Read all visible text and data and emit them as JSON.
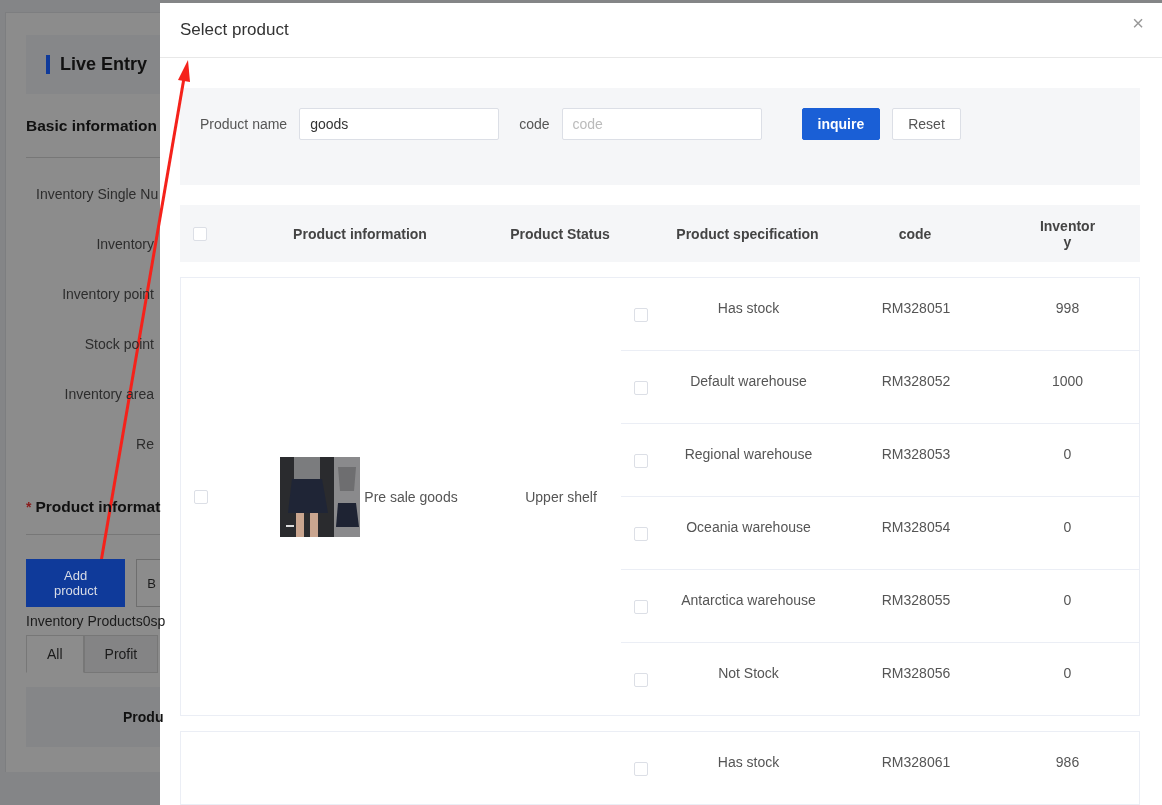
{
  "background_page": {
    "title": "Live Entry",
    "section_basic": "Basic information",
    "fields": [
      "Inventory Single Nu",
      "Inventory",
      "Inventory point",
      "Stock point",
      "Inventory area",
      "Re"
    ],
    "required_mark": "*",
    "section_product": "Product informat",
    "buttons": [
      "Add product",
      "B"
    ],
    "summary": "Inventory Products0sp",
    "tabs": [
      {
        "label": "All",
        "selected": true
      },
      {
        "label": "Profit",
        "selected": false
      }
    ],
    "table_header": "Produ"
  },
  "dialog": {
    "title": "Select product",
    "close": "×",
    "filters": [
      {
        "label": "Product name",
        "value": "goods"
      },
      {
        "label": "code",
        "placeholder": "code"
      }
    ],
    "buttons": [
      {
        "label": "inquire",
        "kind": "primary"
      },
      {
        "label": "Reset",
        "kind": "default"
      }
    ],
    "table": {
      "select_all_checked": false,
      "columns": [
        "Product information",
        "Product Status",
        "Product specification",
        "code",
        "Inventory"
      ],
      "products": [
        {
          "checked": false,
          "name": "Pre sale goods",
          "status": "Upper shelf",
          "specs": [
            {
              "checked": false,
              "name": "Has stock",
              "code": "RM328051",
              "inventory": "998"
            },
            {
              "checked": false,
              "name": "Default warehouse",
              "code": "RM328052",
              "inventory": "1000"
            },
            {
              "checked": false,
              "name": "Regional warehouse",
              "code": "RM328053",
              "inventory": "0"
            },
            {
              "checked": false,
              "name": "Oceania warehouse",
              "code": "RM328054",
              "inventory": "0"
            },
            {
              "checked": false,
              "name": "Antarctica warehouse",
              "code": "RM328055",
              "inventory": "0"
            },
            {
              "checked": false,
              "name": "Not Stock",
              "code": "RM328056",
              "inventory": "0"
            }
          ]
        },
        {
          "specs": [
            {
              "checked": false,
              "name": "Has stock",
              "code": "RM328061",
              "inventory": "986"
            }
          ]
        }
      ]
    }
  }
}
